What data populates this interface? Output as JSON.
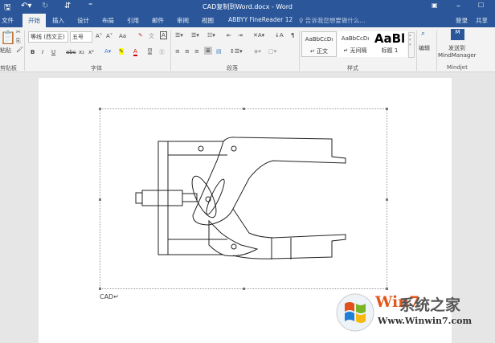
{
  "window": {
    "title": "CAD复制到Word.docx - Word"
  },
  "tabs": [
    {
      "label": "文件"
    },
    {
      "label": "开始"
    },
    {
      "label": "插入"
    },
    {
      "label": "设计"
    },
    {
      "label": "布局"
    },
    {
      "label": "引用"
    },
    {
      "label": "邮件"
    },
    {
      "label": "审阅"
    },
    {
      "label": "视图"
    },
    {
      "label": "ABBYY FineReader 12"
    }
  ],
  "tellme": "♀ 告诉我您想要做什么...",
  "login": "登录",
  "share": "共享",
  "clipboard": {
    "paste": "粘贴",
    "group": "剪贴板"
  },
  "font": {
    "name": "等线 (西文正)",
    "size": "五号",
    "group": "字体",
    "bold": "B",
    "italic": "I",
    "underline": "U",
    "strike": "abc",
    "sub": "x₂",
    "sup": "x²",
    "grow": "A˄",
    "shrink": "A˅",
    "case": "Aa"
  },
  "paragraph": {
    "group": "段落"
  },
  "styles": {
    "group": "样式",
    "items": [
      {
        "preview": "AaBbCcDı",
        "label": "↵ 正文"
      },
      {
        "preview": "AaBbCcDı",
        "label": "↵ 无间隔"
      },
      {
        "preview": "AaBl",
        "label": "标题 1"
      }
    ]
  },
  "editing": {
    "label": "编辑"
  },
  "mindjet": {
    "label1": "发送到",
    "label2": "MindManager",
    "group": "Mindjet"
  },
  "document": {
    "caption": "CAD↵"
  },
  "watermark": {
    "brand_a": "Win7",
    "brand_b": "系统之家",
    "url": "Www.Winwin7.com"
  }
}
